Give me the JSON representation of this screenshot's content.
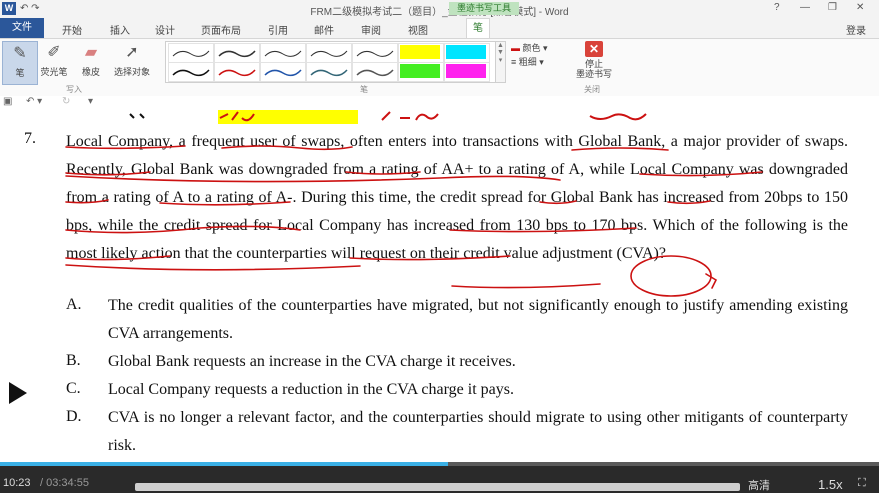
{
  "window": {
    "title": "FRM二级模拟考试二（题目）_金程教育 [兼容模式] - Word",
    "context_tab": "墨迹书写工具",
    "help": "?",
    "min": "—",
    "restore": "❐",
    "close": "✕",
    "quick_access": "↶ ↷"
  },
  "tabs": {
    "file": "文件",
    "items": [
      "开始",
      "插入",
      "设计",
      "页面布局",
      "引用",
      "邮件",
      "审阅",
      "视图"
    ],
    "active": "笔",
    "login": "登录"
  },
  "ribbon": {
    "tools": [
      {
        "label": "笔",
        "icon": "pen-icon"
      },
      {
        "label": "荧光笔",
        "icon": "highlighter-icon"
      },
      {
        "label": "橡皮",
        "icon": "eraser-icon"
      },
      {
        "label": "选择对象",
        "icon": "select-cursor-icon"
      }
    ],
    "group_write": "写入",
    "group_pens": "笔",
    "group_close": "关闭",
    "color_label": "颜色",
    "weight_label": "粗细",
    "stop_label": "停止\n墨迹书写",
    "colors": {
      "ink": "#cc1111",
      "yellow": "#ffff00",
      "cyan": "#00e5ff",
      "green": "#44ee22",
      "magenta": "#ff22ee",
      "stop": "#d9433a"
    }
  },
  "question": {
    "number": "7.",
    "stem": "Local Company, a frequent user of swaps, often enters into transactions with Global Bank, a major provider of swaps. Recently, Global Bank was downgraded from a rating of AA+ to a rating of A, while Local Company was downgraded from a rating of A to a rating of A-. During this time, the credit spread for Global Bank has increased from 20bps to 150 bps, while the credit spread for Local Company has increased from 130 bps to 170 bps. Which of the following is the most likely action that the counterparties will request on their credit value adjustment (CVA)?",
    "options": [
      {
        "letter": "A.",
        "text": "The credit qualities of the counterparties have migrated, but not significantly enough to justify amending existing CVA arrangements."
      },
      {
        "letter": "B.",
        "text": "Global Bank requests an increase in the CVA charge it receives."
      },
      {
        "letter": "C.",
        "text": "Local Company requests a reduction in the CVA charge it pays."
      },
      {
        "letter": "D.",
        "text": "CVA is no longer a relevant factor, and the counterparties should migrate to using other mitigants of counterparty risk."
      }
    ]
  },
  "player": {
    "current_time": "10:23",
    "total_time": "/ 03:34:55",
    "quality": "高清",
    "speed": "1.5x",
    "progress": 0.51
  }
}
